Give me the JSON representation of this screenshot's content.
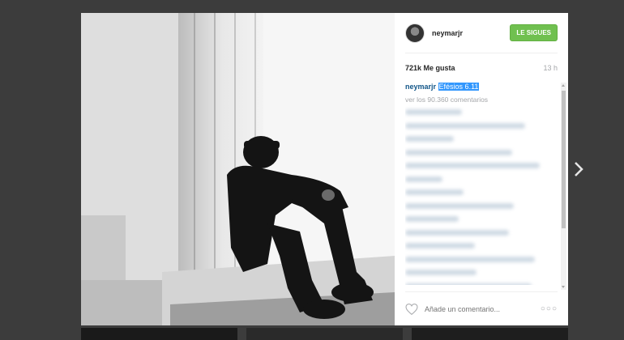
{
  "post": {
    "username": "neymarjr",
    "follow_label": "LE SIGUES",
    "likes": "721k Me gusta",
    "time": "13 h",
    "caption_user": "neymarjr",
    "caption_text": "Efésios 6.11",
    "view_all": "ver los 90.360 comentarios",
    "comment_placeholder": "Añade un comentario...",
    "more_label": "○○○"
  },
  "colors": {
    "follow": "#70c050",
    "caption_highlight": "#3297fd",
    "username_link": "#125688"
  },
  "icons": [
    "heart-icon",
    "more-options-icon",
    "next-arrow-icon"
  ]
}
